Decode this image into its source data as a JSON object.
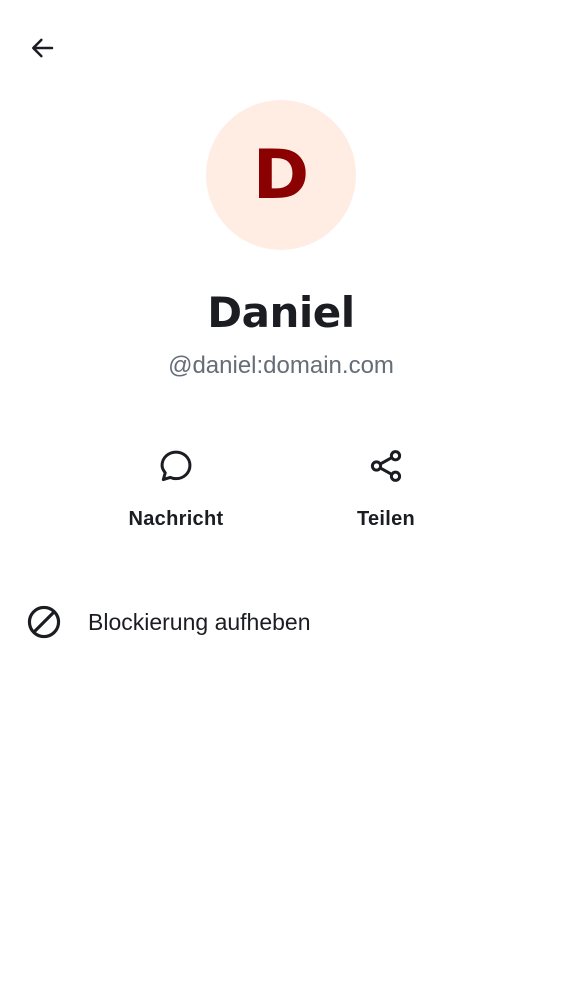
{
  "header": {
    "back_icon": "arrow-left-icon"
  },
  "profile": {
    "avatar_initial": "D",
    "display_name": "Daniel",
    "user_id": "@daniel:domain.com",
    "avatar_bg": "#ffede4",
    "avatar_fg": "#8b0000"
  },
  "actions": [
    {
      "label": "Nachricht",
      "icon": "chat-bubble-icon"
    },
    {
      "label": "Teilen",
      "icon": "share-icon"
    }
  ],
  "list": {
    "unblock_label": "Blockierung aufheben",
    "unblock_icon": "block-icon"
  }
}
